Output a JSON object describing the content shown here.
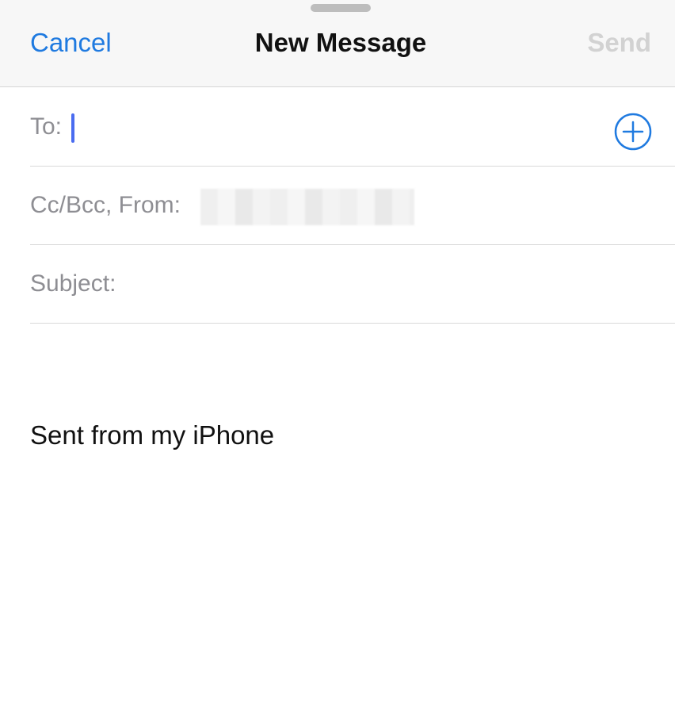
{
  "header": {
    "cancel_label": "Cancel",
    "title": "New Message",
    "send_label": "Send"
  },
  "fields": {
    "to_label": "To:",
    "cc_bcc_from_label": "Cc/Bcc, From:",
    "subject_label": "Subject:"
  },
  "body": {
    "signature": "Sent from my iPhone"
  },
  "colors": {
    "accent": "#1f7ae0",
    "disabled_send": "#d2d2d2",
    "label_gray": "#8e8e93",
    "caret": "#4a6cf0"
  },
  "icons": {
    "add_contact": "plus-circle-icon"
  }
}
